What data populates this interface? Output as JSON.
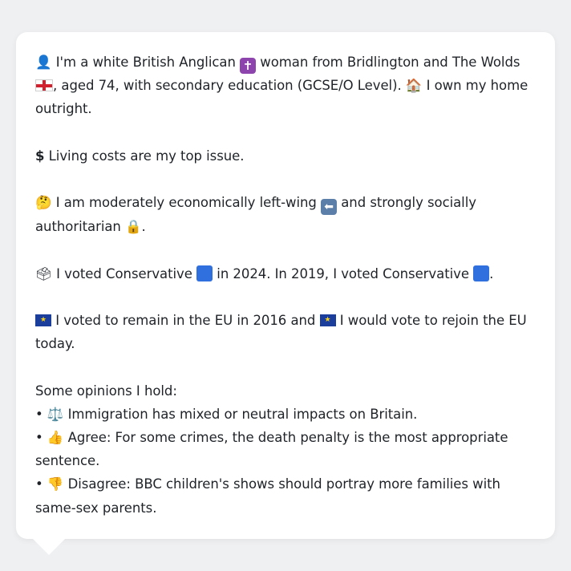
{
  "profile": {
    "intro": {
      "icon": "bust-in-silhouette-icon",
      "part1": "I'm a white British Anglican",
      "religion_icon": "latin-cross-icon",
      "part2": "woman from Bridlington and The Wolds",
      "flag_icon": "england-flag-icon",
      "part3": ", aged 74, with secondary education (GCSE/O Level).",
      "home_icon": "house-icon",
      "part4": "I own my home outright."
    },
    "top_issue": {
      "icon": "dollar-sign-icon",
      "text": "Living costs are my top issue."
    },
    "ideology": {
      "icon": "thinking-face-icon",
      "part1": "I am moderately economically left-wing",
      "left_icon": "left-arrow-icon",
      "part2": "and strongly socially authoritarian",
      "lock_icon": "lock-icon",
      "part3": "."
    },
    "votes": {
      "icon": "ballot-box-icon",
      "part1": "I voted Conservative",
      "party_color": "#2f6fde",
      "part2": "in 2024. In 2019, I voted Conservative",
      "part3": "."
    },
    "eu": {
      "flag_icon": "eu-flag-icon",
      "part1": "I voted to remain in the EU in 2016 and",
      "part2": "I would vote to rejoin the EU today."
    },
    "opinions": {
      "heading": "Some opinions I hold:",
      "items": [
        {
          "bullet": "•",
          "icon": "balance-scale-icon",
          "text": "Immigration has mixed or neutral impacts on Britain."
        },
        {
          "bullet": "•",
          "icon": "thumbs-up-icon",
          "text": "Agree: For some crimes, the death penalty is the most appropriate sentence."
        },
        {
          "bullet": "•",
          "icon": "thumbs-down-icon",
          "text": "Disagree: BBC children's shows should portray more families with same-sex parents."
        }
      ]
    }
  },
  "colors": {
    "background": "#eff0f2",
    "bubble": "#ffffff",
    "text": "#1f2328"
  }
}
